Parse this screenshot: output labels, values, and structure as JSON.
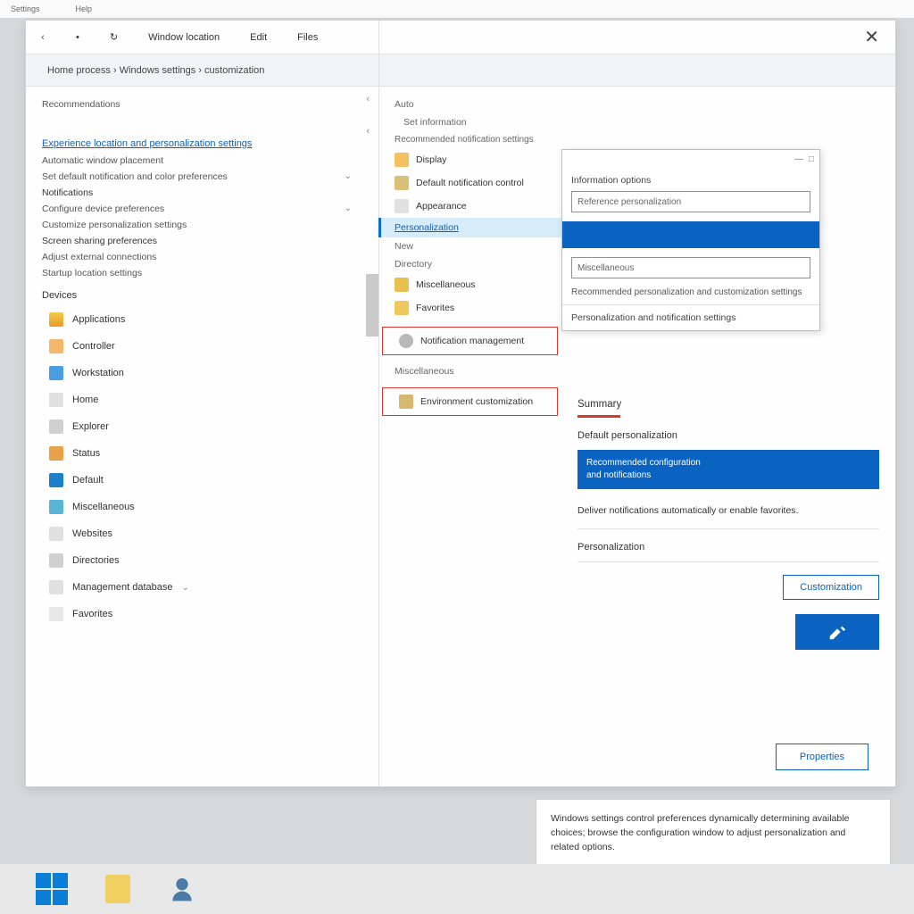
{
  "topbar": {
    "left": "Settings",
    "right": "Help"
  },
  "tabs": {
    "back": "‹",
    "t1": "•",
    "t2": "↻",
    "t3": "Window location",
    "t4": "Edit",
    "t5": "Files"
  },
  "close": "✕",
  "breadcrumb": "Home process › Windows settings › customization",
  "left": {
    "header": "Recommendations",
    "arrow1": "‹",
    "arrow2": "‹",
    "link": "Experience location and personalization settings",
    "items": [
      "Automatic window placement",
      "Set default notification and color preferences",
      "Notifications",
      "Configure device preferences",
      "Customize personalization settings",
      "Screen sharing preferences",
      "Adjust external connections",
      "Startup location settings"
    ],
    "section": "Devices",
    "devices": [
      "Applications",
      "Controller",
      "Workstation",
      "Home",
      "Explorer",
      "Status",
      "Default",
      "Miscellaneous",
      "Websites",
      "Directories",
      "Management database",
      "Favorites"
    ]
  },
  "mid": {
    "h1": "Auto",
    "h2": "Set information",
    "g1": "Recommended notification settings",
    "items1": [
      "Display",
      "Default notification control",
      "Appearance"
    ],
    "selected": "Personalization",
    "h3": "New",
    "h4": "Directory",
    "items2": [
      "Miscellaneous",
      "Favorites"
    ],
    "red1": "Notification management",
    "red2": "Environment customization",
    "h5": "Miscellaneous"
  },
  "popup": {
    "title": "Information options",
    "input1": "Reference personalization",
    "input2": "Miscellaneous",
    "note": "Recommended personalization and customization settings",
    "msg": "Personalization and notification settings"
  },
  "right": {
    "title": "Summary",
    "sub": "Default personalization",
    "bandL1": "Recommended configuration",
    "bandL2": "and notifications",
    "text": "Deliver notifications automatically or enable favorites.",
    "label": "Personalization",
    "btn1": "Customization",
    "btn3": "Properties"
  },
  "info": "Windows settings control preferences dynamically determining available choices; browse the configuration window to adjust personalization and related options.",
  "chevron": "›",
  "minus": "—",
  "square": "□"
}
